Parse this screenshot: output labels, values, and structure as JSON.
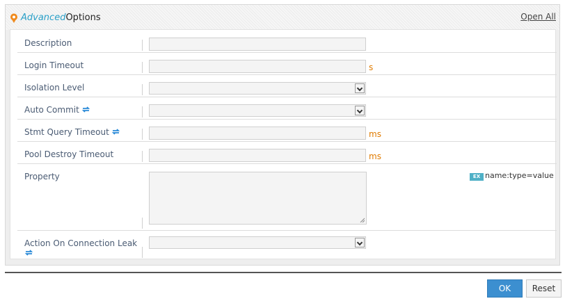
{
  "header": {
    "title_accent": "Advanced",
    "title_main": "Options",
    "open_all": "Open All"
  },
  "rows": [
    {
      "label": "Description",
      "control": "text",
      "value": ""
    },
    {
      "label": "Login Timeout",
      "control": "text",
      "value": "",
      "unit": "s"
    },
    {
      "label": "Isolation Level",
      "control": "select",
      "value": ""
    },
    {
      "label": "Auto Commit",
      "control": "select",
      "value": "",
      "refresh_icon": true
    },
    {
      "label": "Stmt Query Timeout",
      "control": "text",
      "value": "",
      "unit": "ms",
      "refresh_icon": true
    },
    {
      "label": "Pool Destroy Timeout",
      "control": "text",
      "value": "",
      "unit": "ms"
    },
    {
      "label": "Property",
      "control": "textarea",
      "value": "",
      "example_badge": "EX",
      "example_text": "name:type=value"
    },
    {
      "label": "Action On Connection Leak",
      "control": "select",
      "value": "",
      "refresh_icon": true
    }
  ],
  "buttons": {
    "ok": "OK",
    "reset": "Reset"
  },
  "colors": {
    "accent": "#2aa0c8",
    "unit": "#e07b00",
    "label": "#4a5b73",
    "ok_button": "#3c8fd0",
    "refresh_icon": "#2a8ad8"
  }
}
